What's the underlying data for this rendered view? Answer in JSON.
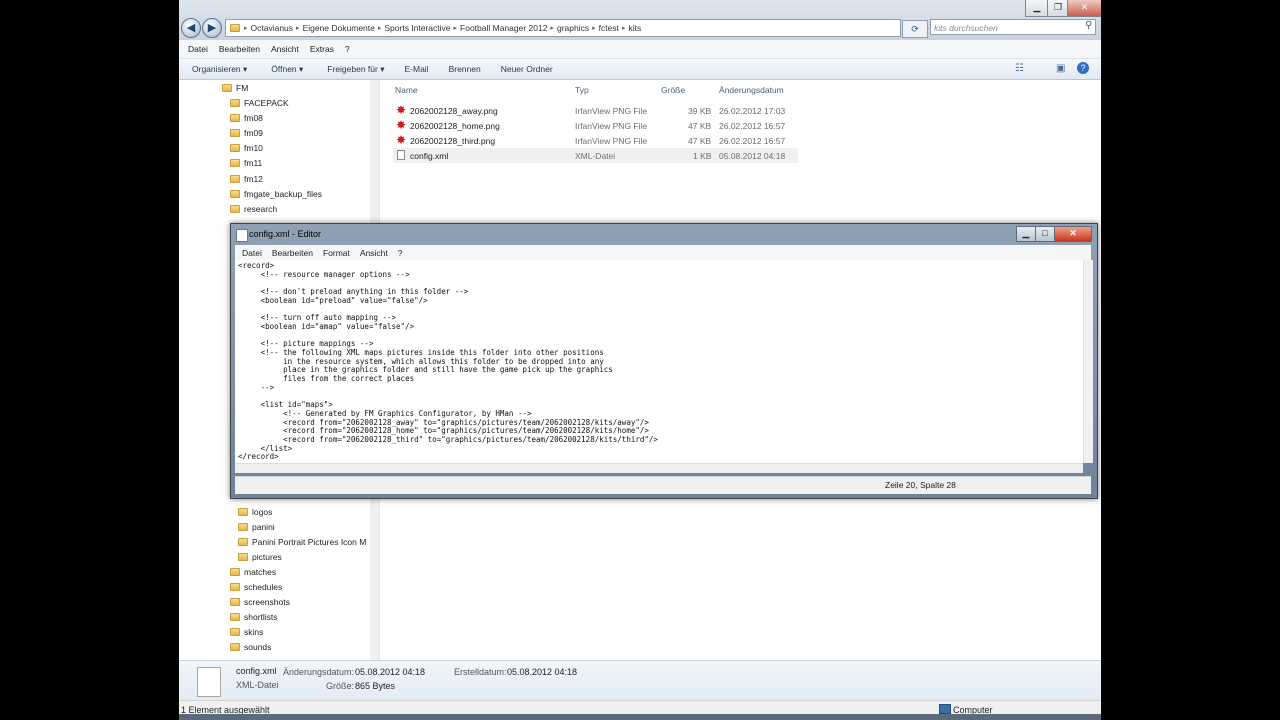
{
  "explorer": {
    "window_controls": {
      "minimize": "▁",
      "maximize": "❐",
      "close": "✕"
    },
    "nav": {
      "back": "◀",
      "forward": "▶"
    },
    "address_segments": [
      "Octavianus",
      "Eigene Dokumente",
      "Sports Interactive",
      "Football Manager 2012",
      "graphics",
      "fctest",
      "kits"
    ],
    "search_placeholder": "kits durchsuchen",
    "menu": [
      "Datei",
      "Bearbeiten",
      "Ansicht",
      "Extras",
      "?"
    ],
    "commands": [
      "Organisieren ▾",
      "Öffnen ▾",
      "Freigeben für ▾",
      "E-Mail",
      "Brennen",
      "Neuer Ordner"
    ],
    "nav_tree_top": [
      "FM",
      "FACEPACK",
      "fm08",
      "fm09",
      "fm10",
      "fm11",
      "fm12",
      "fmgate_backup_files",
      "research"
    ],
    "nav_tree_bottom": [
      "logos",
      "panini",
      "Panini Portrait Pictures Icon M",
      "pictures",
      "matches",
      "schedules",
      "screenshots",
      "shortlists",
      "skins",
      "sounds"
    ],
    "columns": {
      "name": "Name",
      "type": "Typ",
      "size": "Größe",
      "date": "Änderungsdatum"
    },
    "files": [
      {
        "name": "2062002128_away.png",
        "type": "IrfanView PNG File",
        "size": "39 KB",
        "date": "26.02.2012 17:03",
        "icon": "irfanview-png-icon"
      },
      {
        "name": "2062002128_home.png",
        "type": "IrfanView PNG File",
        "size": "47 KB",
        "date": "26.02.2012 16:57",
        "icon": "irfanview-png-icon"
      },
      {
        "name": "2062002128_third.png",
        "type": "IrfanView PNG File",
        "size": "47 KB",
        "date": "26.02.2012 16:57",
        "icon": "irfanview-png-icon"
      },
      {
        "name": "config.xml",
        "type": "XML-Datei",
        "size": "1 KB",
        "date": "05.08.2012 04:18",
        "icon": "xml-file-icon"
      }
    ],
    "details": {
      "filename": "config.xml",
      "filetype": "XML-Datei",
      "modified_label": "Änderungsdatum:",
      "modified_value": "05.08.2012 04:18",
      "created_label": "Erstelldatum:",
      "created_value": "05.08.2012 04:18",
      "size_label": "Größe:",
      "size_value": "865 Bytes"
    },
    "status_left": "1 Element ausgewählt",
    "status_right": "Computer"
  },
  "notepad": {
    "title": "config.xml - Editor",
    "menu": [
      "Datei",
      "Bearbeiten",
      "Format",
      "Ansicht",
      "?"
    ],
    "text": "<record>\n\t<!-- resource manager options -->\n\n\t<!-- don't preload anything in this folder -->\n\t<boolean id=\"preload\" value=\"false\"/>\n\n\t<!-- turn off auto mapping -->\n\t<boolean id=\"amap\" value=\"false\"/>\n\n\t<!-- picture mappings -->\n\t<!-- the following XML maps pictures inside this folder into other positions\n\t\tin the resource system, which allows this folder to be dropped into any\n\t\tplace in the graphics folder and still have the game pick up the graphics\n\t\tfiles from the correct places\n\t-->\n\n\t<list id=\"maps\">\n\t\t<!-- Generated by FM Graphics Configurator, by HMan -->\n\t\t<record from=\"2062002128_away\" to=\"graphics/pictures/team/2062002128/kits/away\"/>\n\t\t<record from=\"2062002128_home\" to=\"graphics/pictures/team/2062002128/kits/home\"/>\n\t\t<record from=\"2062002128_third\" to=\"graphics/pictures/team/2062002128/kits/third\"/>\n\t</list>\n</record>",
    "status": "Zeile 20, Spalte 28",
    "controls": {
      "minimize": "▁",
      "maximize": "□",
      "close": "✕"
    }
  }
}
